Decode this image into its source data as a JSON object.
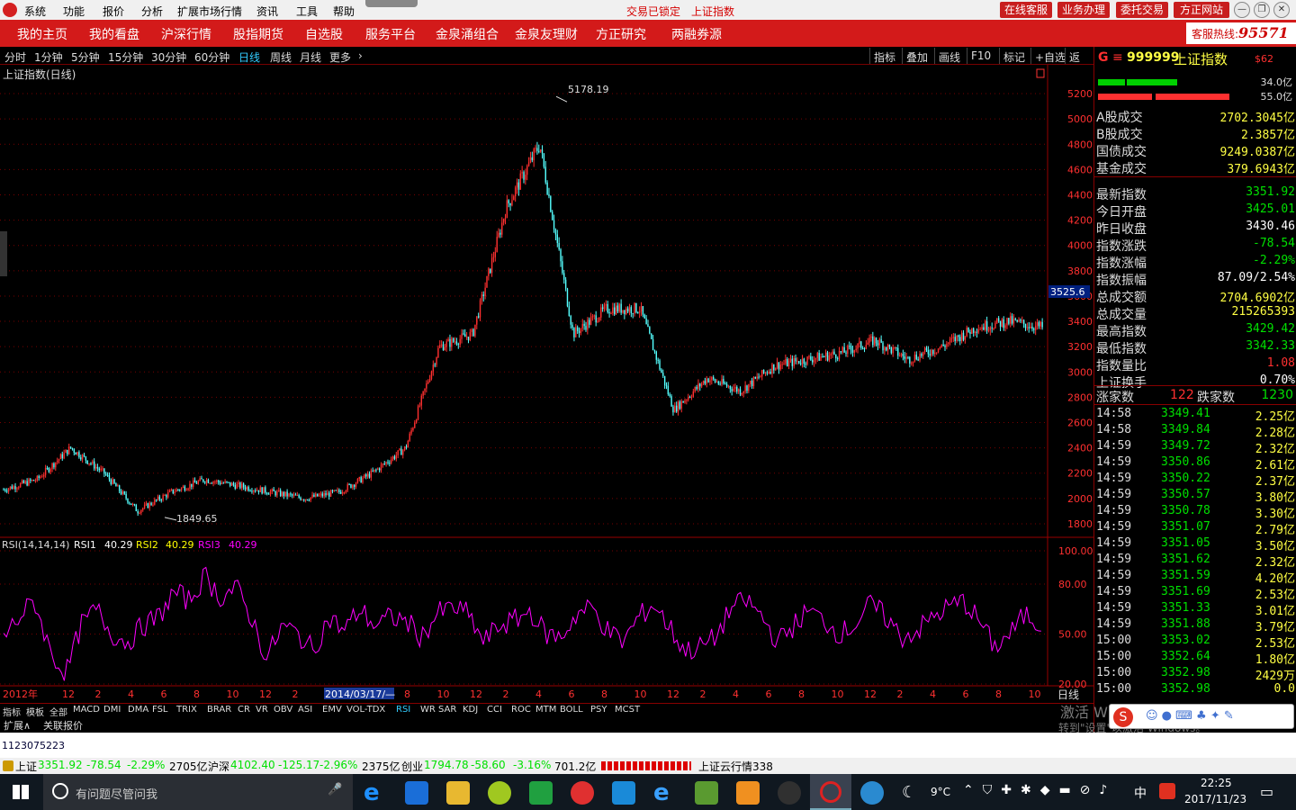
{
  "menu": {
    "items": [
      "系统",
      "功能",
      "报价",
      "分析",
      "扩展市场行情",
      "资讯",
      "工具",
      "帮助"
    ],
    "lock_status": "交易已锁定",
    "index_name": "上证指数",
    "right_buttons": [
      "在线客服",
      "业务办理",
      "委托交易",
      "方正网站"
    ]
  },
  "nav": {
    "items": [
      "我的主页",
      "我的看盘",
      "沪深行情",
      "股指期货",
      "自选股",
      "服务平台",
      "金泉涌组合",
      "金泉友理财",
      "方正研究",
      "两融券源"
    ],
    "hotline_label": "客服热线:",
    "hotline_num": "95571"
  },
  "periods": {
    "items": [
      "分时",
      "1分钟",
      "5分钟",
      "15分钟",
      "30分钟",
      "60分钟",
      "日线",
      "周线",
      "月线",
      "更多"
    ],
    "active": "日线",
    "more_arrow": "›",
    "tools": [
      "指标",
      "叠加",
      "画线",
      "F10",
      "标记",
      "+自选",
      "返回"
    ]
  },
  "chart_data": [
    {
      "type": "candlestick",
      "title": "上证指数(日线)",
      "ylabel": "",
      "ylim": [
        1700,
        5300
      ],
      "yticks": [
        1800,
        2000,
        2200,
        2400,
        2600,
        2800,
        3000,
        3200,
        3400,
        3600,
        3800,
        4000,
        4200,
        4400,
        4600,
        4800,
        5000,
        5200
      ],
      "annotations": {
        "max_label": "5178.19",
        "min_label": "1849.65",
        "crosshair_value": "3525.6"
      },
      "x": [
        "2012-11",
        "2012-12",
        "2013-02",
        "2013-04",
        "2013-06",
        "2013-08",
        "2013-10",
        "2013-12",
        "2014-02",
        "2014-03",
        "2014-06",
        "2014-08",
        "2014-10",
        "2014-12",
        "2015-02",
        "2015-04",
        "2015-06",
        "2015-08",
        "2015-10",
        "2015-12",
        "2016-02",
        "2016-04",
        "2016-06",
        "2016-08",
        "2016-10",
        "2016-12",
        "2017-02",
        "2017-04",
        "2017-06",
        "2017-08",
        "2017-10",
        "2017-11"
      ],
      "close": [
        2070,
        2150,
        2400,
        2200,
        1900,
        2050,
        2150,
        2100,
        2050,
        2000,
        2050,
        2200,
        2400,
        3200,
        3300,
        4300,
        4800,
        3300,
        3500,
        3500,
        2700,
        2950,
        2850,
        3050,
        3100,
        3150,
        3250,
        3100,
        3200,
        3350,
        3400,
        3352
      ]
    },
    {
      "type": "line",
      "title": "RSI(14,14,14)",
      "ylim": [
        20,
        100
      ],
      "yticks": [
        "100.00",
        "80.00",
        "50.00",
        "20.00"
      ],
      "legend": [
        {
          "name": "RSI1",
          "value": "40.29",
          "color": "#ffffff"
        },
        {
          "name": "RSI2",
          "value": "40.29",
          "color": "#ffff00"
        },
        {
          "name": "RSI3",
          "value": "40.29",
          "color": "#ff00ff"
        }
      ],
      "series": [
        {
          "name": "RSI3",
          "values": [
            48,
            60,
            70,
            40,
            25,
            55,
            65,
            50,
            45,
            55,
            60,
            75,
            70,
            85,
            72,
            78,
            60,
            35,
            55,
            50,
            40,
            60,
            52,
            65,
            55,
            60,
            58,
            48,
            62,
            66,
            62,
            45,
            55,
            58,
            64,
            50,
            48,
            62,
            66,
            52,
            45,
            60,
            68,
            54,
            40,
            42,
            48,
            66,
            70,
            60,
            45,
            55,
            64,
            58,
            50,
            56,
            68,
            60,
            48,
            52,
            60,
            66,
            70,
            58,
            42,
            50,
            62,
            55
          ]
        }
      ]
    }
  ],
  "xaxis": {
    "labels": [
      "2012年",
      "12",
      "2",
      "4",
      "6",
      "8",
      "10",
      "12",
      "2",
      "2014/03/17/—",
      "8",
      "10",
      "12",
      "2",
      "4",
      "6",
      "8",
      "10",
      "12",
      "2",
      "4",
      "6",
      "8",
      "10",
      "12",
      "2",
      "4",
      "6",
      "8",
      "10"
    ],
    "period_label": "日线"
  },
  "indicator_tabs": [
    "指标",
    "模板",
    "全部",
    "MACD",
    "DMI",
    "DMA",
    "FSL",
    "TRIX",
    "BRAR",
    "CR",
    "VR",
    "OBV",
    "ASI",
    "EMV",
    "VOL-TDX",
    "RSI",
    "WR",
    "SAR",
    "KDJ",
    "CCI",
    "ROC",
    "MTM",
    "BOLL",
    "PSY",
    "MCST"
  ],
  "bottom_tabs": [
    "扩展∧",
    "关联报价"
  ],
  "code_input": "1123075223",
  "ticker": {
    "sh_label": "上证",
    "sh_val": "3351.92",
    "sh_chg": "-78.54",
    "sh_pct": "-2.29%",
    "sh_amt": "2705亿",
    "sz_label": "沪深",
    "sz_val": "4102.40",
    "sz_chg": "-125.17",
    "sz_pct": "-2.96%",
    "sz_amt": "2375亿",
    "cy_label": "创业",
    "cy_val": "1794.78",
    "cy_chg": "-58.60",
    "cy_pct": "-3.16%",
    "cy_amt": "701.2亿",
    "feed": "上证云行情338"
  },
  "right": {
    "code": "999999",
    "name": "上证指数",
    "tag": "$62",
    "bar_pct_a": "34.0亿",
    "bar_pct_b": "55.0亿",
    "stats": [
      {
        "label": "A股成交",
        "value": "2702.3045亿"
      },
      {
        "label": "B股成交",
        "value": "2.3857亿"
      },
      {
        "label": "国债成交",
        "value": "9249.0387亿"
      },
      {
        "label": "基金成交",
        "value": "379.6943亿"
      },
      {
        "label": "最新指数",
        "value": "3351.92"
      },
      {
        "label": "今日开盘",
        "value": "3425.01"
      },
      {
        "label": "昨日收盘",
        "value": "3430.46"
      },
      {
        "label": "指数涨跌",
        "value": "-78.54"
      },
      {
        "label": "指数涨幅",
        "value": "-2.29%"
      },
      {
        "label": "指数振幅",
        "value": "87.09/2.54%"
      },
      {
        "label": "总成交额",
        "value": "2704.6902亿"
      },
      {
        "label": "总成交量",
        "value": "215265393"
      },
      {
        "label": "最高指数",
        "value": "3429.42"
      },
      {
        "label": "最低指数",
        "value": "3342.33"
      },
      {
        "label": "指数量比",
        "value": "1.08"
      },
      {
        "label": "上证换手",
        "value": "0.70%"
      }
    ],
    "up_label": "涨家数",
    "up_count": "122",
    "down_label": "跌家数",
    "down_count": "1230",
    "ticks": [
      {
        "t": "14:58",
        "p": "3349.41",
        "a": "2.25亿"
      },
      {
        "t": "14:58",
        "p": "3349.84",
        "a": "2.28亿"
      },
      {
        "t": "14:59",
        "p": "3349.72",
        "a": "2.32亿"
      },
      {
        "t": "14:59",
        "p": "3350.86",
        "a": "2.61亿"
      },
      {
        "t": "14:59",
        "p": "3350.22",
        "a": "2.37亿"
      },
      {
        "t": "14:59",
        "p": "3350.57",
        "a": "3.80亿"
      },
      {
        "t": "14:59",
        "p": "3350.78",
        "a": "3.30亿"
      },
      {
        "t": "14:59",
        "p": "3351.07",
        "a": "2.79亿"
      },
      {
        "t": "14:59",
        "p": "3351.05",
        "a": "3.50亿"
      },
      {
        "t": "14:59",
        "p": "3351.62",
        "a": "2.32亿"
      },
      {
        "t": "14:59",
        "p": "3351.59",
        "a": "4.20亿"
      },
      {
        "t": "14:59",
        "p": "3351.69",
        "a": "2.53亿"
      },
      {
        "t": "14:59",
        "p": "3351.33",
        "a": "3.01亿"
      },
      {
        "t": "14:59",
        "p": "3351.88",
        "a": "3.79亿"
      },
      {
        "t": "15:00",
        "p": "3353.02",
        "a": "2.53亿"
      },
      {
        "t": "15:00",
        "p": "3352.64",
        "a": "1.80亿"
      },
      {
        "t": "15:00",
        "p": "3352.98",
        "a": "2429万"
      },
      {
        "t": "15:00",
        "p": "3352.98",
        "a": "0.0"
      }
    ]
  },
  "taskbar": {
    "search_placeholder": "有问题尽管问我",
    "weather": "9°C",
    "ime": "中",
    "time": "22:25",
    "date": "2017/11/23",
    "watermark1": "激活 Windows",
    "watermark2": "转到\"设置\"以激活 Windows。"
  }
}
